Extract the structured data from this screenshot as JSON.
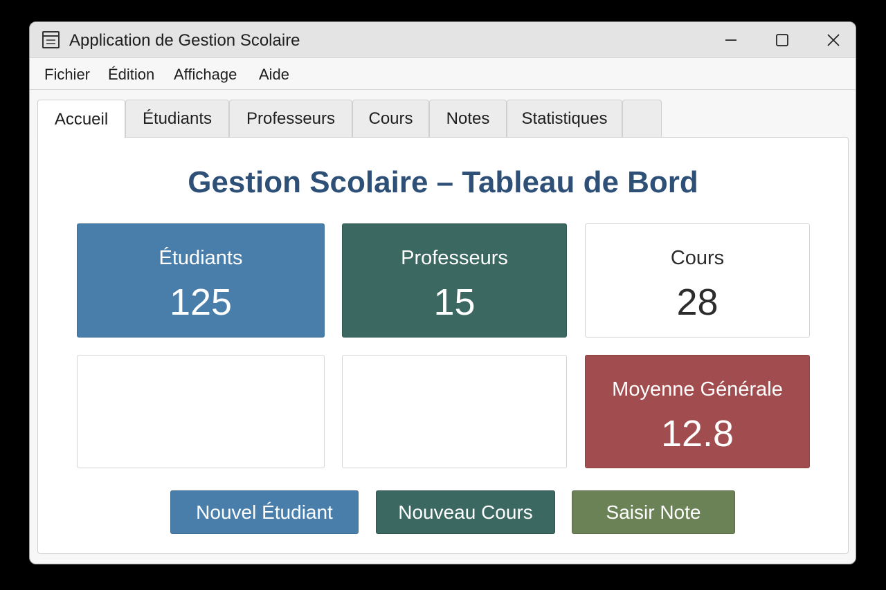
{
  "window": {
    "title": "Application de Gestion Scolaire"
  },
  "menu": [
    "Fichier",
    "Édition",
    "Affichage",
    "Aide"
  ],
  "tabs": [
    "Accueil",
    "Étudiants",
    "Professeurs",
    "Cours",
    "Notes",
    "Statistiques",
    ""
  ],
  "active_tab": "Accueil",
  "dashboard": {
    "title": "Gestion Scolaire – Tableau de Bord",
    "cards": [
      {
        "label": "Étudiants",
        "value": "125",
        "color": "#4a7eaa"
      },
      {
        "label": "Professeurs",
        "value": "15",
        "color": "#3b6860"
      },
      {
        "label": "Cours",
        "value": "28",
        "color": "#ffffff"
      },
      {
        "label": "",
        "value": "",
        "color": "#ffffff"
      },
      {
        "label": "",
        "value": "",
        "color": "#ffffff"
      },
      {
        "label": "Moyenne Générale",
        "value": "12.8",
        "color": "#a14c4e"
      }
    ],
    "actions": [
      {
        "label": "Nouvel Étudiant",
        "color": "#4a7eaa"
      },
      {
        "label": "Nouveau Cours",
        "color": "#3b6860"
      },
      {
        "label": "Saisir Note",
        "color": "#6b8256"
      }
    ]
  },
  "colors": {
    "title_text": "#2e5077",
    "titlebar": "#e4e4e4",
    "window_bg": "#f7f7f7"
  },
  "icons": {
    "app": "window-icon",
    "minimize": "minimize-icon",
    "maximize": "maximize-icon",
    "close": "close-icon"
  }
}
